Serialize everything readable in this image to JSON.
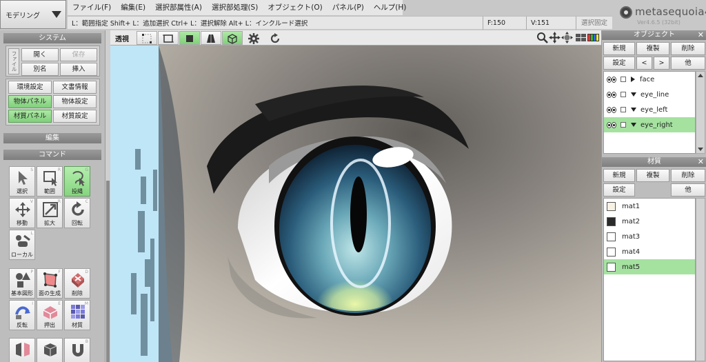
{
  "mode": {
    "label": "モデリング"
  },
  "menu": [
    "ファイル(F)",
    "編集(E)",
    "選択部属性(A)",
    "選択部処理(S)",
    "オブジェクト(O)",
    "パネル(P)",
    "ヘルプ(H)"
  ],
  "status": {
    "hint": "L：範囲指定  Shift+ L：追加選択  Ctrl+ L：選択解除  Alt+ L：インクルード選択",
    "faces": "F:150",
    "vertices": "V:151",
    "select_fix": "選択固定"
  },
  "logo": {
    "text": "metasequoia4",
    "version": "Ver4.6.5 (32bit)"
  },
  "left": {
    "system_header": "システム",
    "file_tab": "ファイル",
    "open": "開く",
    "save": "保存",
    "save_as": "別名",
    "insert": "挿入",
    "env_settings": "環境設定",
    "doc_info": "文書情報",
    "object_panel": "物体パネル",
    "object_settings": "物体設定",
    "material_panel": "材質パネル",
    "material_settings": "材質設定",
    "edit_header": "編集",
    "command_header": "コマンド",
    "tools": [
      {
        "label": "選択",
        "key": "S"
      },
      {
        "label": "範囲",
        "key": "R"
      },
      {
        "label": "投縄",
        "key": "G"
      },
      {
        "label": "移動",
        "key": "V"
      },
      {
        "label": "拡大",
        "key": "R"
      },
      {
        "label": "回転",
        "key": "C"
      },
      {
        "label": "ローカル",
        "key": "L"
      },
      {
        "label": "基本図形",
        "key": "P"
      },
      {
        "label": "面の生成",
        "key": "F"
      },
      {
        "label": "削除",
        "key": "D"
      },
      {
        "label": "反転",
        "key": "I"
      },
      {
        "label": "押出",
        "key": "E"
      },
      {
        "label": "材質",
        "key": "M"
      }
    ]
  },
  "viewbar": {
    "perspective": "透視"
  },
  "objects": {
    "header": "オブジェクト",
    "new": "新規",
    "duplicate": "複製",
    "delete": "削除",
    "settings": "設定",
    "prev": "<",
    "next": ">",
    "other": "他",
    "items": [
      "face",
      "eye_line",
      "eye_left",
      "eye_right"
    ],
    "selected": "eye_right"
  },
  "materials": {
    "header": "材質",
    "new": "新規",
    "duplicate": "複製",
    "delete": "削除",
    "settings": "設定",
    "other": "他",
    "items": [
      {
        "name": "mat1",
        "color": "#f8f2e4"
      },
      {
        "name": "mat2",
        "color": "#2a2a2a"
      },
      {
        "name": "mat3",
        "color": "#ffffff"
      },
      {
        "name": "mat4",
        "color": "#ffffff"
      },
      {
        "name": "mat5",
        "color": "#ffffff"
      }
    ],
    "selected": "mat5"
  },
  "colors": {
    "accent_green": "#a5e2a0",
    "panel_header": "#8a8a8a"
  }
}
